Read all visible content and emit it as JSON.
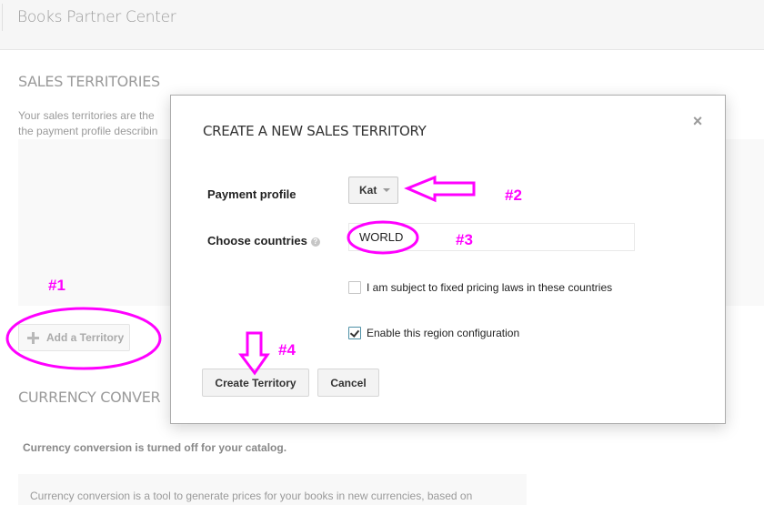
{
  "header": {
    "app_title": "Books Partner Center"
  },
  "sales_territories": {
    "title": "SALES TERRITORIES",
    "intro_line1": "Your sales territories are the",
    "intro_line2": "the payment profile describin",
    "add_button_label": "Add a Territory"
  },
  "currency_conversion": {
    "title": "CURRENCY CONVER",
    "status": "Currency conversion is turned off for your catalog.",
    "description": "Currency conversion is a tool to generate prices for your books in new currencies, based on"
  },
  "modal": {
    "title": "CREATE A NEW SALES TERRITORY",
    "close_icon": "×",
    "payment_profile_label": "Payment profile",
    "payment_profile_value": "Kat",
    "choose_countries_label": "Choose countries",
    "help_icon": "?",
    "countries_value": "WORLD",
    "fixed_pricing_label": "I am subject to fixed pricing laws in these countries",
    "fixed_pricing_checked": false,
    "enable_region_label": "Enable this region configuration",
    "enable_region_checked": true,
    "create_button_label": "Create Territory",
    "cancel_button_label": "Cancel"
  },
  "annotations": {
    "color": "#ff00ff",
    "step1": "#1",
    "step2": "#2",
    "step3": "#3",
    "step4": "#4"
  }
}
